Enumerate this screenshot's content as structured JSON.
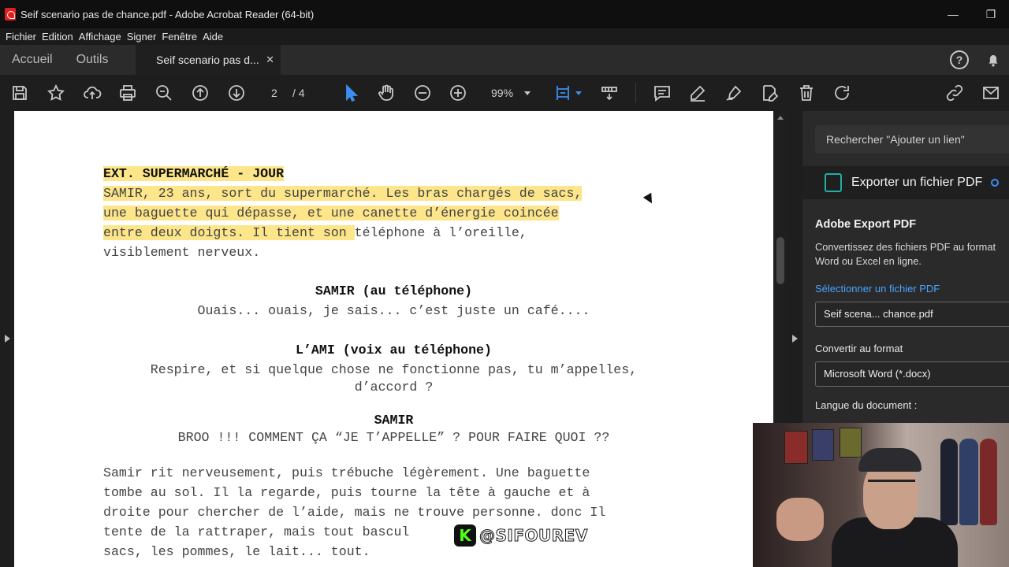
{
  "window": {
    "title": "Seif scenario pas de chance.pdf - Adobe Acrobat Reader (64-bit)",
    "minimize_glyph": "—",
    "restore_glyph": "❐"
  },
  "menu": [
    "Fichier",
    "Edition",
    "Affichage",
    "Signer",
    "Fenêtre",
    "Aide"
  ],
  "tabs": {
    "home": "Accueil",
    "tools": "Outils",
    "document": "Seif scenario pas d...",
    "close_glyph": "✕"
  },
  "toolbar": {
    "current_page": "2",
    "total_pages": "/ 4",
    "zoom": "99%"
  },
  "document": {
    "scene_heading": "EXT. SUPERMARCHÉ - JOUR",
    "action1_highlighted": [
      "SAMIR, 23 ans, sort du supermarché. Les bras chargés de sacs,",
      "une baguette qui dépasse, et une canette d’énergie coincée",
      "entre deux doigts. Il tient son "
    ],
    "action1_rest_line3": "téléphone à l’oreille,",
    "action1_line4": "visiblement nerveux.",
    "char1": "SAMIR (au téléphone)",
    "dial1": "Ouais... ouais, je sais... c’est juste un café....",
    "char2": "L’AMI (voix au téléphone)",
    "dial2_line1": "Respire, et si quelque chose ne fonctionne pas, tu m’appelles,",
    "dial2_line2": "d’accord ?",
    "char3": "SAMIR",
    "dial3": "BROO !!! COMMENT ÇA “JE T’APPELLE” ? POUR FAIRE QUOI ??",
    "action2": [
      "Samir rit nerveusement, puis trébuche légèrement. Une baguette",
      "tombe au sol. Il la regarde, puis tourne la tête à gauche et à",
      "droite pour chercher de l’aide, mais ne trouve personne. donc Il",
      "tente de la rattraper, mais tout bascul",
      "sacs, les pommes, le lait... tout."
    ]
  },
  "right_panel": {
    "search_placeholder": "Rechercher \"Ajouter un lien\"",
    "export_header": "Exporter un fichier PDF",
    "section_title": "Adobe Export PDF",
    "description": "Convertissez des fichiers PDF au format Word ou Excel en ligne.",
    "select_link": "Sélectionner un fichier PDF",
    "selected_file": "Seif scena... chance.pdf",
    "convert_label": "Convertir au format",
    "format_value": "Microsoft Word (*.docx)",
    "language_label": "Langue du document :"
  },
  "watermark": {
    "badge": "K",
    "handle": "@SIFOUREV"
  },
  "colors": {
    "highlight": "#fde58a",
    "link": "#4aa3ff",
    "accent_teal": "#1fb0a8",
    "select_blue": "#3b8ef0"
  }
}
